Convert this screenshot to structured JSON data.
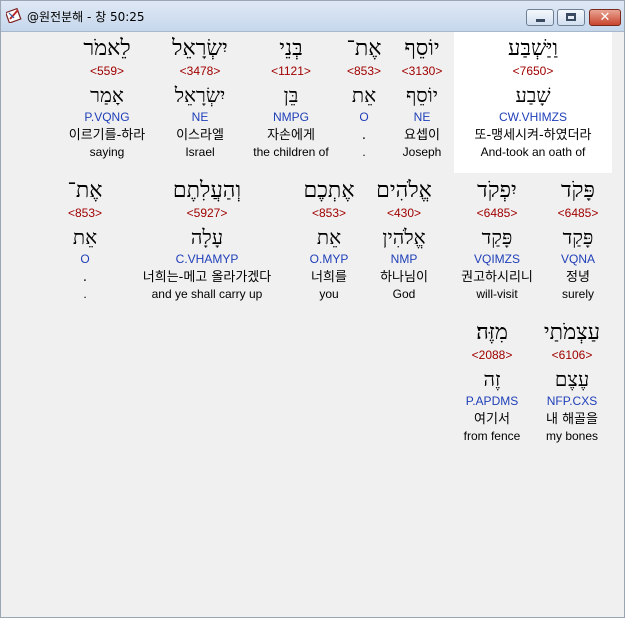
{
  "window": {
    "title": "@원전분해 - 창 50:25",
    "close_glyph": "✕"
  },
  "icons": {
    "app": "bible-app-icon",
    "minimize": "minimize-icon",
    "maximize": "maximize-icon",
    "close": "close-icon"
  },
  "colors": {
    "strong_number": "#a00000",
    "morphology": "#1f3fb8",
    "selected_background": "#ffffff"
  },
  "rows": [
    [
      {
        "hebrew": "וַיַּשְׁבַּע",
        "strong": "<7650>",
        "lemma": "שָׁבַע",
        "morph": "CW.VHIMZS",
        "korean": "또-맹세시켜-하였더라",
        "english": "And-took an oath of",
        "selected": true
      },
      {
        "hebrew": "יוֹסֵף",
        "strong": "<3130>",
        "lemma": "יוֹסֵף",
        "morph": "NE",
        "korean": "요셉이",
        "english": "Joseph"
      },
      {
        "hebrew": "אֶת־",
        "strong": "<853>",
        "lemma": "אֵת",
        "morph": "O",
        "korean": ".",
        "english": "."
      },
      {
        "hebrew": "בְּנֵי",
        "strong": "<1121>",
        "lemma": "בֵּן",
        "morph": "NMPG",
        "korean": "자손에게",
        "english": "the children of"
      },
      {
        "hebrew": "יִשְׂרָאֵל",
        "strong": "<3478>",
        "lemma": "יִשְׂרָאֵל",
        "morph": "NE",
        "korean": "이스라엘",
        "english": "Israel"
      },
      {
        "hebrew": "לֵאמֹר",
        "strong": "<559>",
        "lemma": "אָמַר",
        "morph": "P.VQNG",
        "korean": "이르기를-하라",
        "english": "saying"
      }
    ],
    [
      {
        "hebrew": "פָּקֹד",
        "strong": "<6485>",
        "lemma": "פָּקַד",
        "morph": "VQNA",
        "korean": "정녕",
        "english": "surely"
      },
      {
        "hebrew": "יִפְקֹד",
        "strong": "<6485>",
        "lemma": "פָּקַד",
        "morph": "VQIMZS",
        "korean": "권고하시리니",
        "english": "will-visit"
      },
      {
        "hebrew": "אֱלֹהִים",
        "strong": "<430>",
        "lemma": "אֱלֹהִין",
        "morph": "NMP",
        "korean": "하나님이",
        "english": "God"
      },
      {
        "hebrew": "אֶתְכֶם",
        "strong": "<853>",
        "lemma": "אֵת",
        "morph": "O.MYP",
        "korean": "너희를",
        "english": "you"
      },
      {
        "hebrew": "וְהַעֲלִתֶם",
        "strong": "<5927>",
        "lemma": "עָלָה",
        "morph": "C.VHAMYP",
        "korean": "너희는-메고 올라가겠다",
        "english": "and ye shall carry up"
      },
      {
        "hebrew": "אֶת־",
        "strong": "<853>",
        "lemma": "אֵת",
        "morph": "O",
        "korean": ".",
        "english": "."
      }
    ],
    [
      {
        "hebrew": "עַצְמֹתַי",
        "strong": "<6106>",
        "lemma": "עֶצֶם",
        "morph": "NFP.CXS",
        "korean": "내 해골을",
        "english": "my bones"
      },
      {
        "hebrew": "מִזֶּה׃",
        "strong": "<2088>",
        "lemma": "זֶה",
        "morph": "P.APDMS",
        "korean": "여기서",
        "english": "from fence"
      }
    ]
  ]
}
